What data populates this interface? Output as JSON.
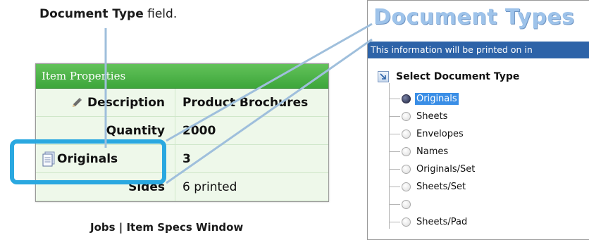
{
  "callout": {
    "field_bold": "Document Type",
    "field_rest": " field."
  },
  "caption": "Jobs | Item Specs Window",
  "props": {
    "header": "Item Properties",
    "rows": [
      {
        "label": "Description",
        "value": "Product Brochures",
        "icon": "pencil-icon"
      },
      {
        "label": "Quantity",
        "value": "2000"
      },
      {
        "label": "Originals",
        "value": "3",
        "icon": "document-icon"
      },
      {
        "label": "Sides",
        "value": "6 printed"
      }
    ]
  },
  "dialog": {
    "title": "Document Types",
    "banner": "This information will be printed on in",
    "tree_root": "Select Document Type",
    "options": [
      {
        "label": "Originals",
        "selected": true
      },
      {
        "label": "Sheets",
        "selected": false
      },
      {
        "label": "Envelopes",
        "selected": false
      },
      {
        "label": "Names",
        "selected": false
      },
      {
        "label": "Originals/Set",
        "selected": false
      },
      {
        "label": "Sheets/Set",
        "selected": false
      },
      {
        "label": "",
        "selected": false
      },
      {
        "label": "Sheets/Pad",
        "selected": false
      }
    ]
  },
  "colors": {
    "highlight": "#2aa8e0",
    "header_green": "#3da63b",
    "banner_blue": "#2d63a8",
    "title_blue": "#9ec3ea",
    "selection_blue": "#3a8ee6"
  }
}
